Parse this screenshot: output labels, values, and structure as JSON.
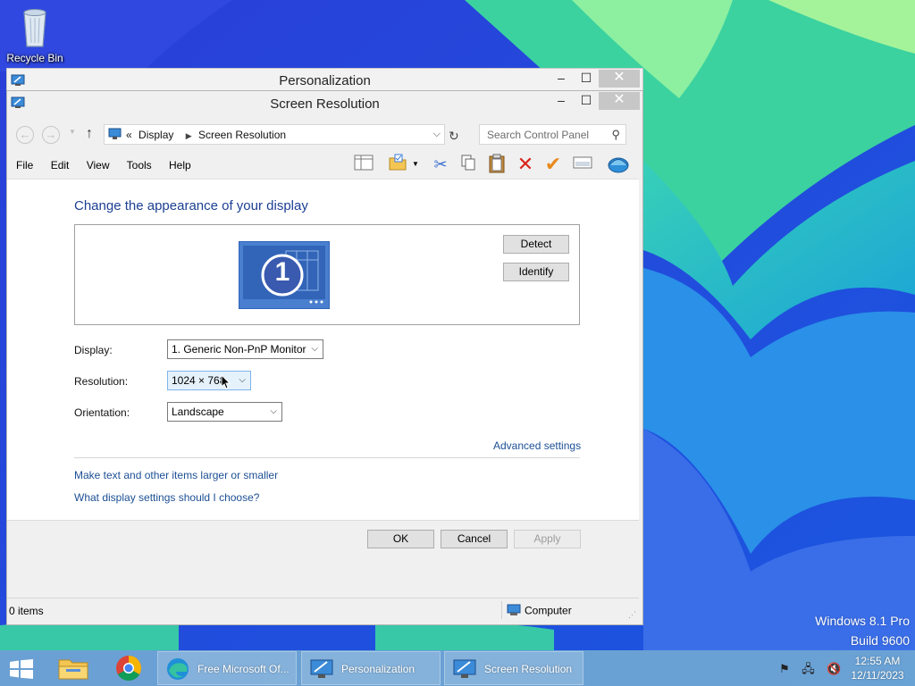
{
  "desktop": {
    "recycle_bin_label": "Recycle Bin",
    "watermark_line1": "Windows 8.1 Pro",
    "watermark_line2": "Build 9600"
  },
  "back_window": {
    "title": "Personalization"
  },
  "window": {
    "title": "Screen Resolution",
    "address": {
      "prefix": "«",
      "crumbs": [
        "Display",
        "Screen Resolution"
      ],
      "search_placeholder": "Search Control Panel"
    },
    "menu": [
      "File",
      "Edit",
      "View",
      "Tools",
      "Help"
    ],
    "content": {
      "heading": "Change the appearance of your display",
      "monitor_number": "1",
      "detect_label": "Detect",
      "identify_label": "Identify",
      "display_label": "Display:",
      "display_value": "1. Generic Non-PnP Monitor",
      "resolution_label": "Resolution:",
      "resolution_value": "1024 × 768",
      "orientation_label": "Orientation:",
      "orientation_value": "Landscape",
      "advanced_link": "Advanced settings",
      "link_text_size": "Make text and other items larger or smaller",
      "link_display_settings": "What display settings should I choose?"
    },
    "buttons": {
      "ok": "OK",
      "cancel": "Cancel",
      "apply": "Apply"
    },
    "status": {
      "items": "0 items",
      "location": "Computer"
    }
  },
  "taskbar": {
    "items": [
      "Free Microsoft Of...",
      "Personalization",
      "Screen Resolution"
    ],
    "clock_time": "12:55 AM",
    "clock_date": "12/11/2023"
  },
  "colors": {
    "accent_link": "#1c4f95",
    "heading": "#1c3f94"
  }
}
